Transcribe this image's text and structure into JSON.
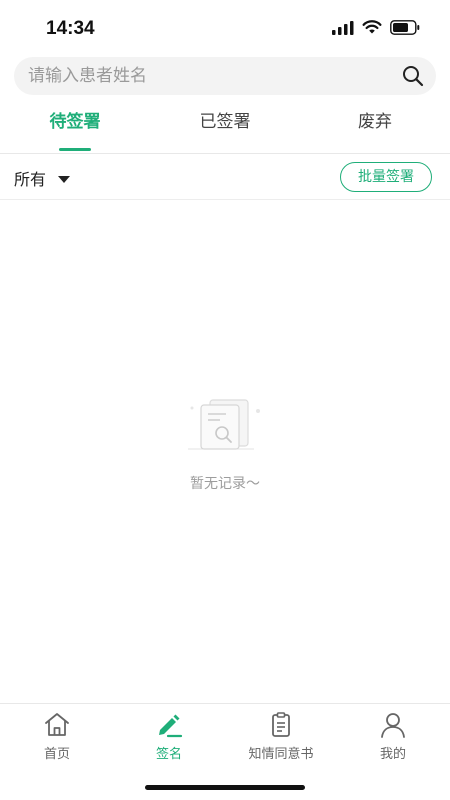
{
  "status_bar": {
    "time": "14:34"
  },
  "search": {
    "placeholder": "请输入患者姓名"
  },
  "tabs": [
    {
      "label": "待签署",
      "active": true
    },
    {
      "label": "已签署",
      "active": false
    },
    {
      "label": "废弃",
      "active": false
    }
  ],
  "filter": {
    "selected": "所有",
    "batch_sign_label": "批量签署"
  },
  "empty_state": {
    "message": "暂无记录～"
  },
  "bottom_nav": [
    {
      "label": "首页",
      "icon": "home-icon",
      "active": false
    },
    {
      "label": "签名",
      "icon": "pen-icon",
      "active": true
    },
    {
      "label": "知情同意书",
      "icon": "clipboard-icon",
      "active": false
    },
    {
      "label": "我的",
      "icon": "user-icon",
      "active": false
    }
  ],
  "colors": {
    "accent": "#1fae79",
    "inactive": "#666666",
    "placeholder": "#9a9a9a"
  }
}
